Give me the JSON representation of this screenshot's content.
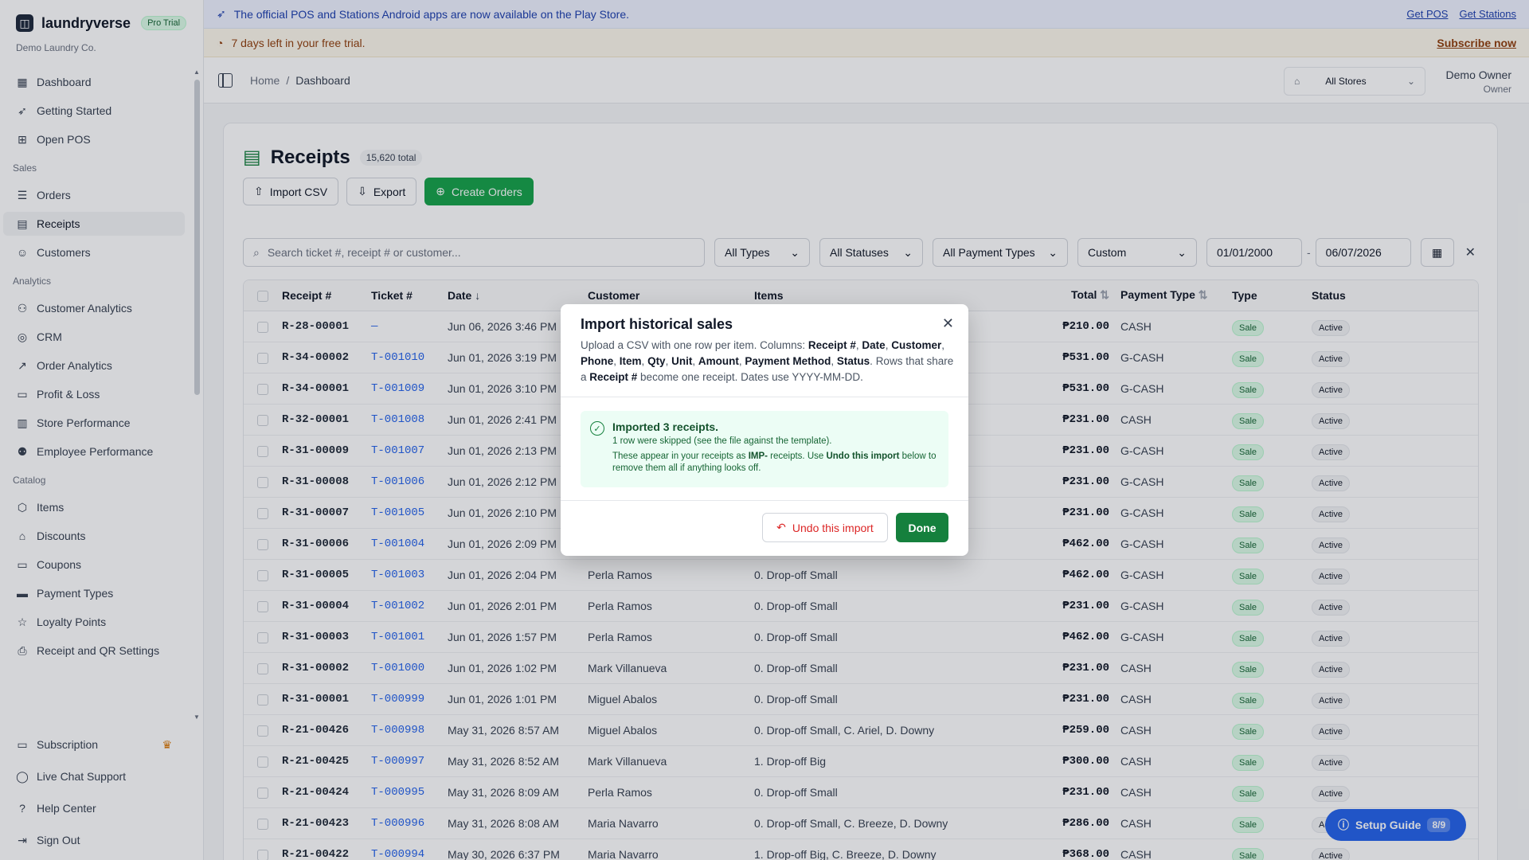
{
  "brand": {
    "name": "laundryverse",
    "plan_badge": "Pro Trial",
    "company": "Demo Laundry Co."
  },
  "nav": {
    "top": [
      {
        "label": "Dashboard",
        "icon": "dashboard-icon"
      },
      {
        "label": "Getting Started",
        "icon": "rocket-icon"
      },
      {
        "label": "Open POS",
        "icon": "pos-icon"
      }
    ],
    "sections": [
      {
        "title": "Sales",
        "items": [
          {
            "label": "Orders",
            "icon": "orders-icon"
          },
          {
            "label": "Receipts",
            "icon": "receipt-icon",
            "active": true
          },
          {
            "label": "Customers",
            "icon": "users-icon"
          }
        ]
      },
      {
        "title": "Analytics",
        "items": [
          {
            "label": "Customer Analytics",
            "icon": "user-chart-icon"
          },
          {
            "label": "CRM",
            "icon": "target-icon"
          },
          {
            "label": "Order Analytics",
            "icon": "trend-icon"
          },
          {
            "label": "Profit & Loss",
            "icon": "money-icon"
          },
          {
            "label": "Store Performance",
            "icon": "bar-chart-icon"
          },
          {
            "label": "Employee Performance",
            "icon": "user-star-icon"
          }
        ]
      },
      {
        "title": "Catalog",
        "items": [
          {
            "label": "Items",
            "icon": "box-icon"
          },
          {
            "label": "Discounts",
            "icon": "tag-icon"
          },
          {
            "label": "Coupons",
            "icon": "ticket-icon"
          },
          {
            "label": "Payment Types",
            "icon": "card-icon"
          },
          {
            "label": "Loyalty Points",
            "icon": "star-icon"
          },
          {
            "label": "Receipt and QR Settings",
            "icon": "printer-icon"
          }
        ]
      }
    ],
    "bottom": [
      {
        "label": "Subscription",
        "icon": "subscription-icon"
      },
      {
        "label": "Live Chat Support",
        "icon": "chat-icon"
      },
      {
        "label": "Help Center",
        "icon": "help-icon"
      },
      {
        "label": "Sign Out",
        "icon": "sign-out-icon"
      }
    ]
  },
  "banners": {
    "play_store": "The official POS and Stations Android apps are now available on the Play Store.",
    "get_pos": "Get POS",
    "get_stations": "Get Stations",
    "trial": "7 days left in your free trial.",
    "subscribe": "Subscribe now"
  },
  "topbar": {
    "crumb_home": "Home",
    "crumb_sep": "/",
    "crumb_current": "Dashboard",
    "store": "All Stores",
    "user_name": "Demo Owner",
    "user_role": "Owner"
  },
  "page": {
    "title": "Receipts",
    "total": "15,620 total",
    "buttons": {
      "import": "Import CSV",
      "export": "Export",
      "create": "Create Orders"
    },
    "search_placeholder": "Search ticket #, receipt # or customer...",
    "filters": {
      "types": "All Types",
      "statuses": "All Statuses",
      "payment": "All Payment Types",
      "range": "Custom",
      "from": "01/01/2000",
      "sep": "-",
      "to": "06/07/2026"
    }
  },
  "table": {
    "headers": {
      "receipt": "Receipt #",
      "ticket": "Ticket #",
      "date": "Date",
      "customer": "Customer",
      "items": "Items",
      "total": "Total",
      "payment": "Payment Type",
      "type": "Type",
      "status": "Status"
    },
    "rows": [
      [
        "R-28-00001",
        "—",
        "Jun 06, 2026 3:46 PM",
        "",
        "",
        "₱210.00",
        "CASH",
        "Sale",
        "Active"
      ],
      [
        "R-34-00002",
        "T-001010",
        "Jun 01, 2026 3:19 PM",
        "",
        "",
        "₱531.00",
        "G-CASH",
        "Sale",
        "Active"
      ],
      [
        "R-34-00001",
        "T-001009",
        "Jun 01, 2026 3:10 PM",
        "",
        "",
        "₱531.00",
        "G-CASH",
        "Sale",
        "Active"
      ],
      [
        "R-32-00001",
        "T-001008",
        "Jun 01, 2026 2:41 PM",
        "",
        "",
        "₱231.00",
        "CASH",
        "Sale",
        "Active"
      ],
      [
        "R-31-00009",
        "T-001007",
        "Jun 01, 2026 2:13 PM",
        "",
        "",
        "₱231.00",
        "G-CASH",
        "Sale",
        "Active"
      ],
      [
        "R-31-00008",
        "T-001006",
        "Jun 01, 2026 2:12 PM",
        "",
        "",
        "₱231.00",
        "G-CASH",
        "Sale",
        "Active"
      ],
      [
        "R-31-00007",
        "T-001005",
        "Jun 01, 2026 2:10 PM",
        "",
        "",
        "₱231.00",
        "G-CASH",
        "Sale",
        "Active"
      ],
      [
        "R-31-00006",
        "T-001004",
        "Jun 01, 2026 2:09 PM",
        "",
        "",
        "₱462.00",
        "G-CASH",
        "Sale",
        "Active"
      ],
      [
        "R-31-00005",
        "T-001003",
        "Jun 01, 2026 2:04 PM",
        "Perla Ramos",
        "0. Drop-off Small",
        "₱462.00",
        "G-CASH",
        "Sale",
        "Active"
      ],
      [
        "R-31-00004",
        "T-001002",
        "Jun 01, 2026 2:01 PM",
        "Perla Ramos",
        "0. Drop-off Small",
        "₱231.00",
        "G-CASH",
        "Sale",
        "Active"
      ],
      [
        "R-31-00003",
        "T-001001",
        "Jun 01, 2026 1:57 PM",
        "Perla Ramos",
        "0. Drop-off Small",
        "₱462.00",
        "G-CASH",
        "Sale",
        "Active"
      ],
      [
        "R-31-00002",
        "T-001000",
        "Jun 01, 2026 1:02 PM",
        "Mark Villanueva",
        "0. Drop-off Small",
        "₱231.00",
        "CASH",
        "Sale",
        "Active"
      ],
      [
        "R-31-00001",
        "T-000999",
        "Jun 01, 2026 1:01 PM",
        "Miguel Abalos",
        "0. Drop-off Small",
        "₱231.00",
        "CASH",
        "Sale",
        "Active"
      ],
      [
        "R-21-00426",
        "T-000998",
        "May 31, 2026 8:57 AM",
        "Miguel Abalos",
        "0. Drop-off Small, C. Ariel, D. Downy",
        "₱259.00",
        "CASH",
        "Sale",
        "Active"
      ],
      [
        "R-21-00425",
        "T-000997",
        "May 31, 2026 8:52 AM",
        "Mark Villanueva",
        "1. Drop-off Big",
        "₱300.00",
        "CASH",
        "Sale",
        "Active"
      ],
      [
        "R-21-00424",
        "T-000995",
        "May 31, 2026 8:09 AM",
        "Perla Ramos",
        "0. Drop-off Small",
        "₱231.00",
        "CASH",
        "Sale",
        "Active"
      ],
      [
        "R-21-00423",
        "T-000996",
        "May 31, 2026 8:08 AM",
        "Maria Navarro",
        "0. Drop-off Small, C. Breeze, D. Downy",
        "₱286.00",
        "CASH",
        "Sale",
        "Active"
      ],
      [
        "R-21-00422",
        "T-000994",
        "May 30, 2026 6:37 PM",
        "Maria Navarro",
        "1. Drop-off Big, C. Breeze, D. Downy",
        "₱368.00",
        "CASH",
        "Sale",
        "Active"
      ]
    ]
  },
  "modal": {
    "title": "Import historical sales",
    "desc_prefix": "Upload a CSV with one row per item. Columns: ",
    "columns": [
      "Receipt #",
      "Date",
      "Customer",
      "Phone",
      "Item",
      "Qty",
      "Unit",
      "Amount",
      "Payment Method",
      "Status"
    ],
    "desc_rows_prefix": "Rows that share a ",
    "desc_rows_key": "Receipt #",
    "desc_rows_suffix": " become one receipt. Dates use YYYY-MM-DD.",
    "success_title": "Imported 3 receipts.",
    "success_line1": "1 row were skipped (see the file against the template).",
    "success_line2a": "These appear in your receipts as ",
    "success_imp": "IMP-",
    "success_line2b": " receipts. Use ",
    "success_undo_ref": "Undo this import",
    "success_line2c": " below to remove them all if anything looks off.",
    "undo": "Undo this import",
    "done": "Done"
  },
  "setup_guide": {
    "label": "Setup Guide",
    "progress": "8/9"
  },
  "colors": {
    "primary": "#16a34a",
    "link": "#2563eb",
    "danger": "#dc2626"
  }
}
